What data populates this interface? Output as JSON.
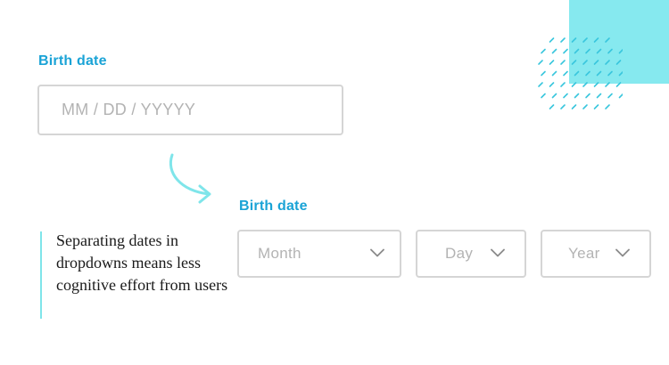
{
  "top_field": {
    "label": "Birth date",
    "placeholder": "MM / DD / YYYYY"
  },
  "bottom_field": {
    "label": "Birth date",
    "selects": [
      {
        "placeholder": "Month",
        "icon": "chevron-down-icon"
      },
      {
        "placeholder": "Day",
        "icon": "chevron-down-icon"
      },
      {
        "placeholder": "Year",
        "icon": "chevron-down-icon"
      }
    ]
  },
  "caption": "Separating dates in dropdowns means less cognitive effort from users",
  "colors": {
    "label": "#1aa3d6",
    "border": "#d5d5d5",
    "placeholder": "#b3b3b3",
    "accent": "#86e9ef",
    "arrow": "#7fe5ea"
  }
}
